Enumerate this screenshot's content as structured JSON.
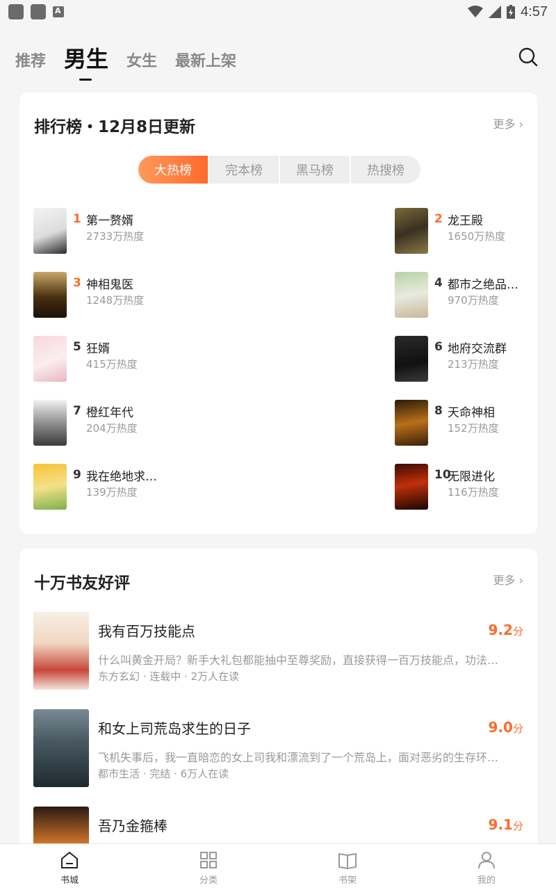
{
  "status_bar": {
    "time": "4:57"
  },
  "top_tabs": [
    {
      "label": "推荐",
      "active": false
    },
    {
      "label": "男生",
      "active": true
    },
    {
      "label": "女生",
      "active": false
    },
    {
      "label": "最新上架",
      "active": false
    }
  ],
  "ranking": {
    "title": "排行榜・12月8日更新",
    "more": "更多 ›",
    "segments": [
      "大热榜",
      "完本榜",
      "黑马榜",
      "热搜榜"
    ],
    "active_segment": 0,
    "items": [
      {
        "rank": "1",
        "name": "第一赘婿",
        "heat": "2733万热度"
      },
      {
        "rank": "2",
        "name": "龙王殿",
        "heat": "1650万热度"
      },
      {
        "rank": "3",
        "name": "神相鬼医",
        "heat": "1248万热度"
      },
      {
        "rank": "4",
        "name": "都市之绝品…",
        "heat": "970万热度"
      },
      {
        "rank": "5",
        "name": "狂婿",
        "heat": "415万热度"
      },
      {
        "rank": "6",
        "name": "地府交流群",
        "heat": "213万热度"
      },
      {
        "rank": "7",
        "name": "橙红年代",
        "heat": "204万热度"
      },
      {
        "rank": "8",
        "name": "天命神相",
        "heat": "152万热度"
      },
      {
        "rank": "9",
        "name": "我在绝地求…",
        "heat": "139万热度"
      },
      {
        "rank": "10",
        "name": "无限进化",
        "heat": "116万热度"
      }
    ]
  },
  "reviews": {
    "title": "十万书友好评",
    "more": "更多 ›",
    "items": [
      {
        "title": "我有百万技能点",
        "score": "9.2",
        "unit": "分",
        "desc": "什么叫黄金开局？新手大礼包都能抽中至尊奖励，直接获得一百万技能点，功法…",
        "meta": "东方玄幻 · 连载中 · 2万人在读"
      },
      {
        "title": "和女上司荒岛求生的日子",
        "score": "9.0",
        "unit": "分",
        "desc": "飞机失事后，我一直暗恋的女上司我和漂流到了一个荒岛上，面对恶劣的生存环…",
        "meta": "都市生活 · 完结 · 6万人在读"
      },
      {
        "title": "吾乃金箍棒",
        "score": "9.1",
        "unit": "分",
        "desc": "",
        "meta": ""
      }
    ]
  },
  "bottom_nav": [
    {
      "label": "书城",
      "icon": "home-icon",
      "active": true
    },
    {
      "label": "分类",
      "icon": "grid-icon",
      "active": false
    },
    {
      "label": "书架",
      "icon": "book-icon",
      "active": false
    },
    {
      "label": "我的",
      "icon": "user-icon",
      "active": false
    }
  ],
  "colors": {
    "accent": "#ff6a2b",
    "background": "#f5f5f5"
  }
}
